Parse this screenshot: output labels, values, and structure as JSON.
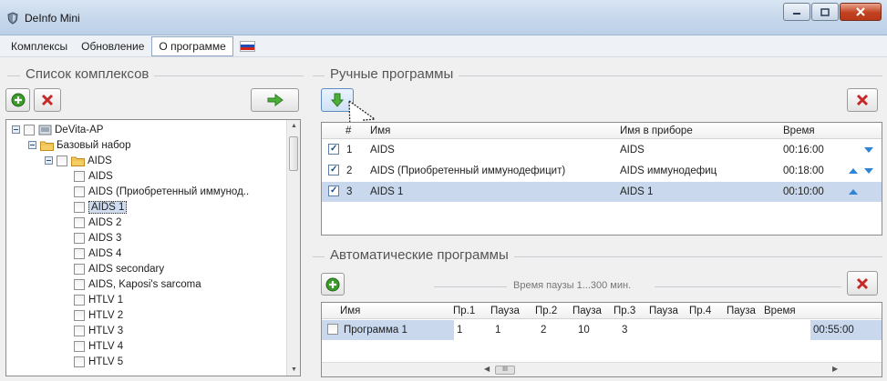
{
  "window": {
    "title": "DeInfo Mini"
  },
  "menu": {
    "items": [
      "Комплексы",
      "Обновление",
      "О программе"
    ],
    "active_index": 2
  },
  "complexes": {
    "title": "Список комплексов",
    "tree": [
      {
        "label": "DeVita-AP",
        "level": 0,
        "expander": true,
        "checkbox": true,
        "icon": "device-icon"
      },
      {
        "label": "Базовый набор",
        "level": 1,
        "expander": true,
        "checkbox": false,
        "icon": "folder-icon"
      },
      {
        "label": "AIDS",
        "level": 2,
        "expander": true,
        "checkbox": true,
        "icon": "folder-icon"
      },
      {
        "label": "AIDS",
        "level": 3,
        "checkbox": true
      },
      {
        "label": "AIDS  (Приобретенный иммунод..",
        "level": 3,
        "checkbox": true
      },
      {
        "label": "AIDS 1",
        "level": 3,
        "checkbox": true,
        "selected": true
      },
      {
        "label": "AIDS 2",
        "level": 3,
        "checkbox": true
      },
      {
        "label": "AIDS 3",
        "level": 3,
        "checkbox": true
      },
      {
        "label": "AIDS 4",
        "level": 3,
        "checkbox": true
      },
      {
        "label": "AIDS secondary",
        "level": 3,
        "checkbox": true
      },
      {
        "label": "AIDS, Kaposi's sarcoma",
        "level": 3,
        "checkbox": true
      },
      {
        "label": "HTLV 1",
        "level": 3,
        "checkbox": true
      },
      {
        "label": "HTLV 2",
        "level": 3,
        "checkbox": true
      },
      {
        "label": "HTLV 3",
        "level": 3,
        "checkbox": true
      },
      {
        "label": "HTLV 4",
        "level": 3,
        "checkbox": true
      },
      {
        "label": "HTLV 5",
        "level": 3,
        "checkbox": true
      }
    ]
  },
  "manual": {
    "title": "Ручные программы",
    "columns": [
      "#",
      "Имя",
      "Имя в приборе",
      "Время"
    ],
    "rows": [
      {
        "checked": true,
        "num": "1",
        "name": "AIDS",
        "device_name": "AIDS",
        "time": "00:16:00",
        "up": false,
        "down": true
      },
      {
        "checked": true,
        "num": "2",
        "name": "AIDS (Приобретенный иммунодефицит)",
        "device_name": "AIDS иммунодефиц",
        "time": "00:18:00",
        "up": true,
        "down": true
      },
      {
        "checked": true,
        "num": "3",
        "name": "AIDS 1",
        "device_name": "AIDS 1",
        "time": "00:10:00",
        "up": true,
        "down": false,
        "selected": true
      }
    ]
  },
  "auto": {
    "title": "Автоматические программы",
    "pause_hint": "Время паузы 1...300 мин.",
    "columns": [
      "Имя",
      "Пр.1",
      "Пауза",
      "Пр.2",
      "Пауза",
      "Пр.3",
      "Пауза",
      "Пр.4",
      "Пауза",
      "Время"
    ],
    "rows": [
      {
        "checked": false,
        "cells": [
          "Программа 1",
          "1",
          "1",
          "2",
          "10",
          "3",
          "",
          "",
          "",
          "00:55:00"
        ]
      }
    ],
    "hscroll_thumb": "III"
  },
  "colors": {
    "accent_green": "#3c9a2a",
    "delete_red": "#c62828",
    "selection": "#c9d8ec"
  }
}
